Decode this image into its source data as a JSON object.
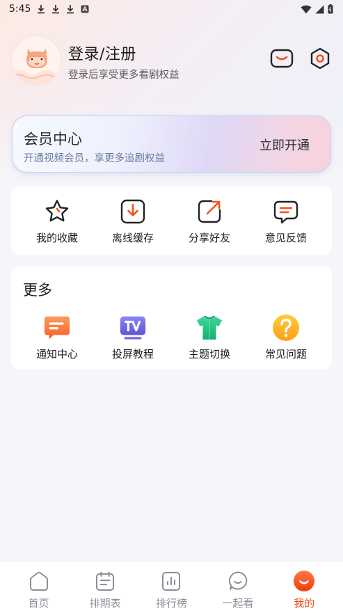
{
  "status_bar": {
    "time": "5:45"
  },
  "header": {
    "title": "登录/注册",
    "subtitle": "登录后享受更多看剧权益"
  },
  "vip": {
    "title": "会员中心",
    "subtitle": "开通视频会员，享更多追剧权益",
    "button": "立即开通"
  },
  "quick_actions": [
    {
      "label": "我的收藏",
      "icon": "star-icon"
    },
    {
      "label": "离线缓存",
      "icon": "download-icon"
    },
    {
      "label": "分享好友",
      "icon": "share-icon"
    },
    {
      "label": "意见反馈",
      "icon": "feedback-icon"
    }
  ],
  "more": {
    "title": "更多",
    "items": [
      {
        "label": "通知中心",
        "icon": "notification-icon"
      },
      {
        "label": "投屏教程",
        "icon": "tv-cast-icon"
      },
      {
        "label": "主题切换",
        "icon": "theme-shirt-icon"
      },
      {
        "label": "常见问题",
        "icon": "question-icon"
      }
    ]
  },
  "tabs": [
    {
      "label": "首页",
      "icon": "home-icon"
    },
    {
      "label": "排期表",
      "icon": "calendar-icon"
    },
    {
      "label": "排行榜",
      "icon": "ranking-icon"
    },
    {
      "label": "一起看",
      "icon": "watch-together-icon"
    },
    {
      "label": "我的",
      "icon": "profile-icon",
      "active": true
    }
  ],
  "colors": {
    "accent": "#f2521c",
    "tab_inactive": "#8a8f99",
    "vip_border": "#bcd0ef"
  }
}
